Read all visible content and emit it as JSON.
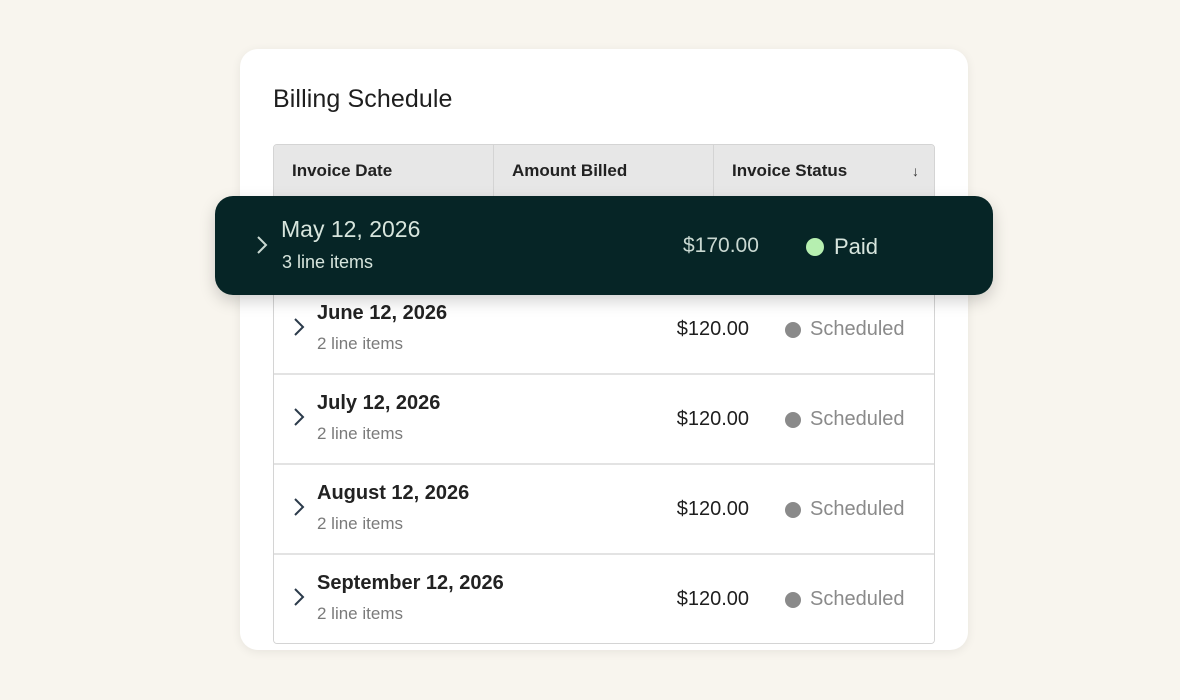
{
  "card": {
    "title": "Billing Schedule"
  },
  "table": {
    "columns": [
      "Invoice Date",
      "Amount Billed",
      "Invoice Status"
    ],
    "sort_icon": "↓",
    "highlighted_row": {
      "date": "May 12, 2026",
      "line_items": "3 line items",
      "amount": "$170.00",
      "status": "Paid",
      "status_color": "#b6efb0"
    },
    "rows": [
      {
        "date": "June 12, 2026",
        "line_items": "2 line items",
        "amount": "$120.00",
        "status": "Scheduled"
      },
      {
        "date": "July 12, 2026",
        "line_items": "2 line items",
        "amount": "$120.00",
        "status": "Scheduled"
      },
      {
        "date": "August 12, 2026",
        "line_items": "2 line items",
        "amount": "$120.00",
        "status": "Scheduled"
      },
      {
        "date": "September 12, 2026",
        "line_items": "2 line items",
        "amount": "$120.00",
        "status": "Scheduled"
      }
    ]
  },
  "colors": {
    "background": "#f8f5ee",
    "highlight_bg": "#062526",
    "scheduled_dot": "#8a8a8a"
  }
}
